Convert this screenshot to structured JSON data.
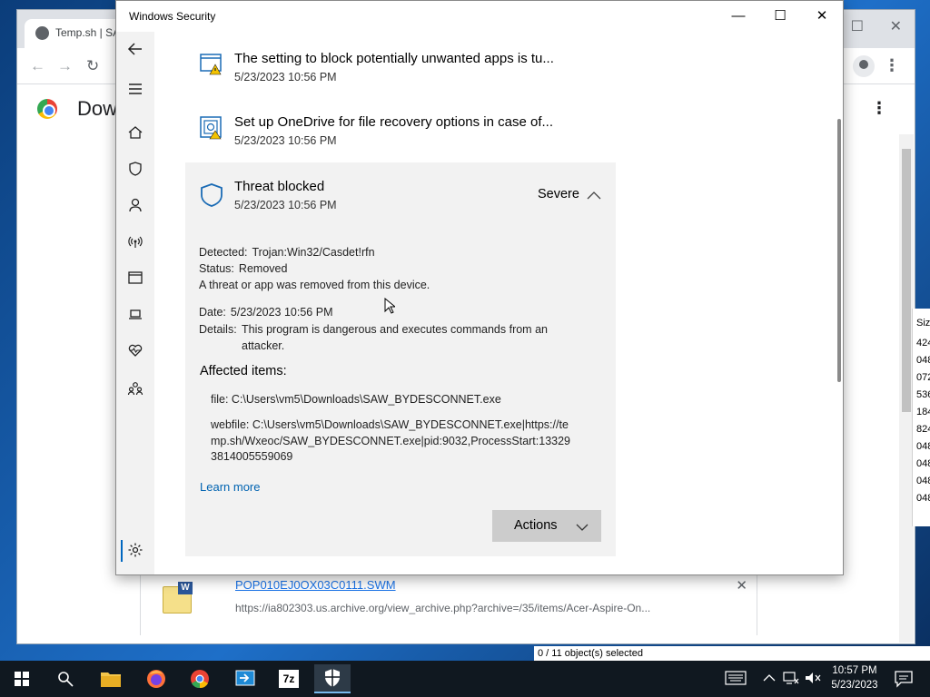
{
  "desktop": {
    "chrome": {
      "tab_title": "Temp.sh | SA",
      "page_heading": "Dow",
      "download": {
        "filename": "POP010EJ0OX03C0111.SWM",
        "url": "https://ia802303.us.archive.org/view_archive.php?archive=/35/items/Acer-Aspire-On...",
        "file_badge": "W"
      }
    },
    "explorer": {
      "column_header": "Size",
      "rows": [
        "424",
        "048",
        "072",
        "536",
        "184",
        "824",
        "048",
        "048",
        "048",
        "048"
      ],
      "status": "0 / 11 object(s) selected"
    }
  },
  "security_window": {
    "title": "Windows Security",
    "notifications": [
      {
        "title": "The setting to block potentially unwanted apps is tu...",
        "time": "5/23/2023 10:56 PM",
        "icon": "app-browser-warning-icon"
      },
      {
        "title": "Set up OneDrive for file recovery options in case of...",
        "time": "5/23/2023 10:56 PM",
        "icon": "file-recovery-icon"
      }
    ],
    "threat": {
      "title": "Threat blocked",
      "time": "5/23/2023 10:56 PM",
      "severity": "Severe",
      "detected_label": "Detected:",
      "detected_value": "Trojan:Win32/Casdet!rfn",
      "status_label": "Status:",
      "status_value": "Removed",
      "status_note": "A threat or app was removed from this device.",
      "date_label": "Date:",
      "date_value": "5/23/2023 10:56 PM",
      "details_label": "Details:",
      "details_value": "This program is dangerous and executes commands from an attacker.",
      "affected_heading": "Affected items:",
      "affected_items": [
        "file: C:\\Users\\vm5\\Downloads\\SAW_BYDESCONNET.exe",
        "webfile: C:\\Users\\vm5\\Downloads\\SAW_BYDESCONNET.exe|https://temp.sh/Wxeoc/SAW_BYDESCONNET.exe|pid:9032,ProcessStart:133293814005559069"
      ],
      "learn_more": "Learn more",
      "actions_label": "Actions"
    }
  },
  "taskbar": {
    "time": "10:57 PM",
    "date": "5/23/2023",
    "apps": [
      "file-explorer-icon",
      "firefox-icon",
      "chrome-icon",
      "remote-app-icon",
      "7zip-icon",
      "windows-security-icon"
    ],
    "sevenzip_label": "7z"
  }
}
